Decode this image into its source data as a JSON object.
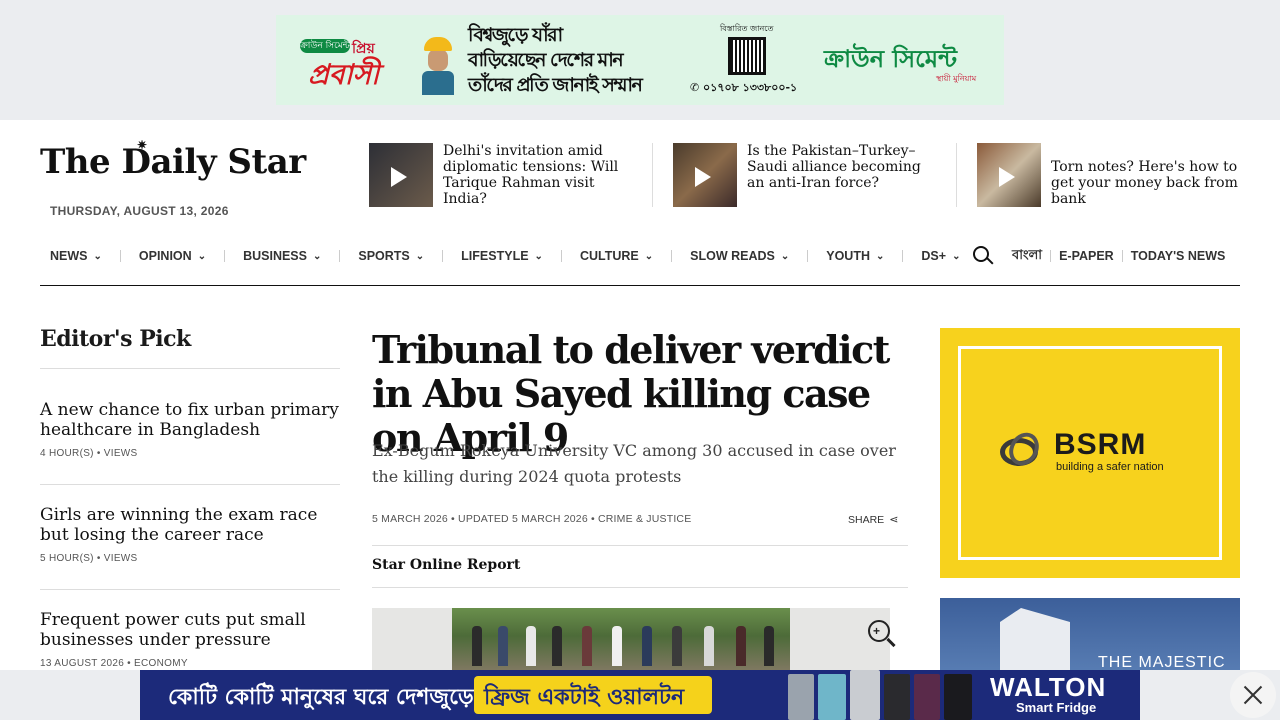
{
  "top_ad": {
    "pill_small": "ক্রাউন সিমেন্ট",
    "pill_small2": "প্রিয়",
    "pill_main": "প্রবাসী",
    "headline_lines": [
      "বিশ্বজুড়ে যাঁরা",
      "বাড়িয়েছেন দেশের মান",
      "তাঁদের প্রতি জানাই সম্মান"
    ],
    "qr_label": "বিস্তারিত জানতে",
    "phone": "০১৭০৮ ১৩৩৮০০-১",
    "brand": "ক্রাউন সিমেন্ট",
    "brand_sub": "স্থায়ী মুনিয়াম"
  },
  "header": {
    "logo": "The Daily Star",
    "date": "THURSDAY, AUGUST 13, 2026"
  },
  "top_stories": [
    {
      "title": "Delhi's invitation amid diplomatic tensions: Will Tarique Rahman visit India?",
      "thumb_color": "#3b3f4a"
    },
    {
      "title": "Is the Pakistan–Turkey–Saudi alliance becoming an anti-Iran force?",
      "thumb_color": "#5a4a3a"
    },
    {
      "title": "Torn notes? Here's how to get your money back from bank",
      "thumb_color": "#6b4c3b"
    }
  ],
  "nav": {
    "items": [
      "NEWS",
      "OPINION",
      "BUSINESS",
      "SPORTS",
      "LIFESTYLE",
      "CULTURE",
      "SLOW READS",
      "YOUTH",
      "DS+"
    ],
    "bangla": "বাংলা",
    "epaper": "E-PAPER",
    "todays_news": "TODAY'S NEWS"
  },
  "editors_pick": {
    "title": "Editor's Pick",
    "items": [
      {
        "headline": "A new chance to fix urban primary healthcare in Bangladesh",
        "meta": "4 HOUR(S)  •  VIEWS"
      },
      {
        "headline": "Girls are winning the exam race but losing the career race",
        "meta": "5 HOUR(S)  •  VIEWS"
      },
      {
        "headline": "Frequent power cuts put small businesses under pressure",
        "meta": "13 AUGUST 2026  •  ECONOMY"
      }
    ]
  },
  "article": {
    "headline": "Tribunal to deliver verdict in Abu Sayed killing case on April 9",
    "subhead": "Ex-Begum Rokeya University VC among 30 accused in case over the killing during 2024 quota protests",
    "meta": "5 MARCH 2026  •  UPDATED 5 MARCH 2026  •  CRIME & JUSTICE",
    "share": "SHARE",
    "author": "Star Online Report"
  },
  "right_ads": {
    "bsrm_brand": "BSRM",
    "bsrm_tag": "building a safer nation",
    "majestic": "THE MAJESTIC"
  },
  "bottom_ad": {
    "text1": "কোটি কোটি মানুষের ঘরে দেশজুড়ে",
    "text2": "ফ্রিজ একটাই ওয়ালটন",
    "brand": "WALTON",
    "product": "Smart Fridge"
  }
}
